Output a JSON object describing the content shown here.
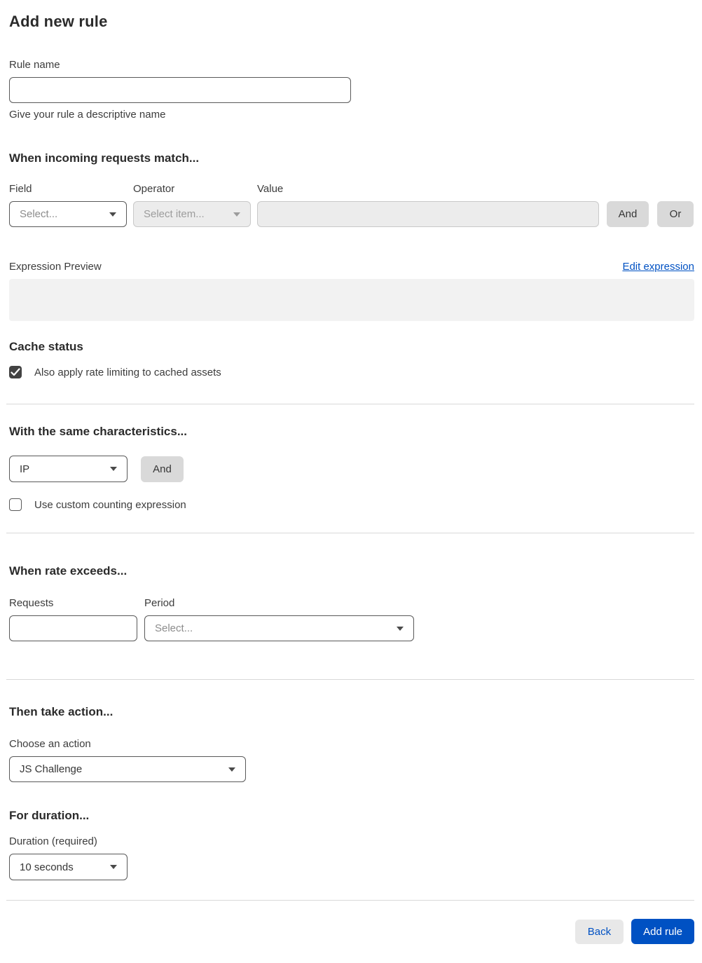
{
  "page": {
    "title": "Add new rule"
  },
  "rule_name": {
    "label": "Rule name",
    "value": "",
    "helper": "Give your rule a descriptive name"
  },
  "match": {
    "heading": "When incoming requests match...",
    "field_label": "Field",
    "field_value": "Select...",
    "operator_label": "Operator",
    "operator_value": "Select item...",
    "value_label": "Value",
    "value_value": "",
    "and_label": "And",
    "or_label": "Or"
  },
  "expression": {
    "label": "Expression Preview",
    "edit_link": "Edit expression",
    "preview_value": ""
  },
  "cache": {
    "heading": "Cache status",
    "checkbox_label": "Also apply rate limiting to cached assets",
    "checked": true
  },
  "characteristics": {
    "heading": "With the same characteristics...",
    "select_value": "IP",
    "and_label": "And",
    "checkbox_label": "Use custom counting expression",
    "checked": false
  },
  "rate": {
    "heading": "When rate exceeds...",
    "requests_label": "Requests",
    "requests_value": "",
    "period_label": "Period",
    "period_value": "Select..."
  },
  "action": {
    "heading": "Then take action...",
    "choose_label": "Choose an action",
    "selected_value": "JS Challenge"
  },
  "duration": {
    "heading": "For duration...",
    "label": "Duration (required)",
    "selected_value": "10 seconds"
  },
  "footer": {
    "back_label": "Back",
    "add_rule_label": "Add rule"
  },
  "colors": {
    "accent_blue": "#0051c3",
    "checkbox_checked": "#424242",
    "disabled_bg": "#ececec",
    "divider": "#d9d9d9"
  }
}
